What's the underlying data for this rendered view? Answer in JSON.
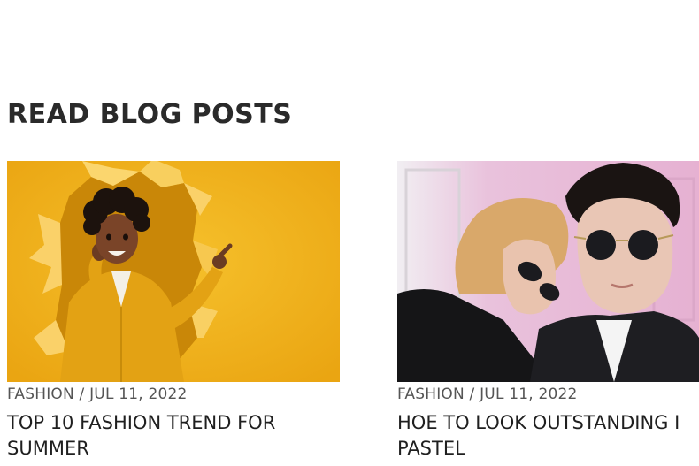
{
  "section": {
    "title": "READ BLOG POSTS"
  },
  "posts": [
    {
      "category": "FASHION",
      "separator": "/",
      "date": "JUL 11, 2022",
      "title": "TOP 10 FASHION TREND FOR SUMMER",
      "image_alt": "Woman in yellow jacket pointing through torn yellow paper"
    },
    {
      "category": "FASHION",
      "separator": "/",
      "date": "JUL 11, 2022",
      "title_line1": "HOE TO LOOK OUTSTANDING I",
      "title_line2": "PASTEL",
      "image_alt": "Couple wearing sunglasses against pink background"
    }
  ],
  "colors": {
    "yellow_bg": "#f2b21c",
    "yellow_jacket": "#e0a010",
    "pink_bg": "#e8b7d6",
    "dark_suit": "#1e1e22"
  }
}
